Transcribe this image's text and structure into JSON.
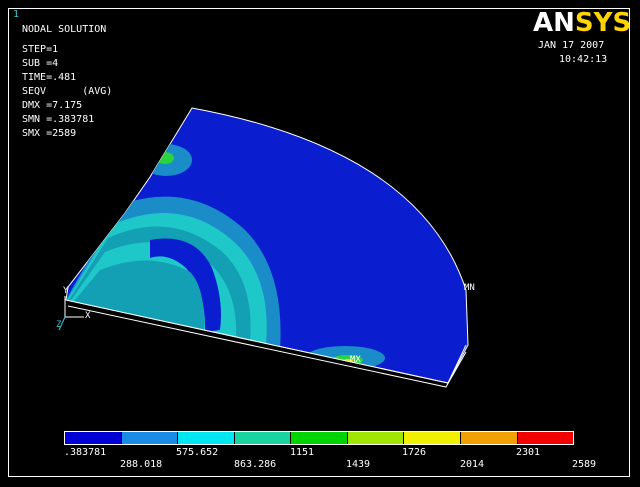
{
  "window_number": "1",
  "info": {
    "lines": [
      "NODAL SOLUTION",
      "STEP=1",
      "SUB =4",
      "TIME=.481",
      "SEQV      (AVG)",
      "DMX =7.175",
      "SMN =.383781",
      "SMX =2589"
    ]
  },
  "logo": {
    "part1": "AN",
    "part2": "SYS"
  },
  "date": "JAN 17 2007",
  "time": "10:42:13",
  "model_tags": {
    "mn": "MN",
    "mx": "MX"
  },
  "axes": {
    "x": "X",
    "y": "Y",
    "z": "Z"
  },
  "legend": {
    "colors": [
      "#0000d4",
      "#1a8ce6",
      "#00e6f0",
      "#1ad4a0",
      "#00d400",
      "#a0e600",
      "#f0f000",
      "#f0a000",
      "#f00000"
    ],
    "top_labels": [
      ".383781",
      "575.652",
      "1151",
      "1726",
      "2301"
    ],
    "bottom_labels": [
      "288.018",
      "863.286",
      "1439",
      "2014",
      "2589"
    ]
  },
  "palette": {
    "model_base": "#0a1ed0",
    "band_light": "#1a8cc8",
    "band_cyan": "#1ec8c8",
    "band_teal": "#14a0b4",
    "hot_green": "#2ad43c",
    "hot_yellow": "#e6e600"
  }
}
